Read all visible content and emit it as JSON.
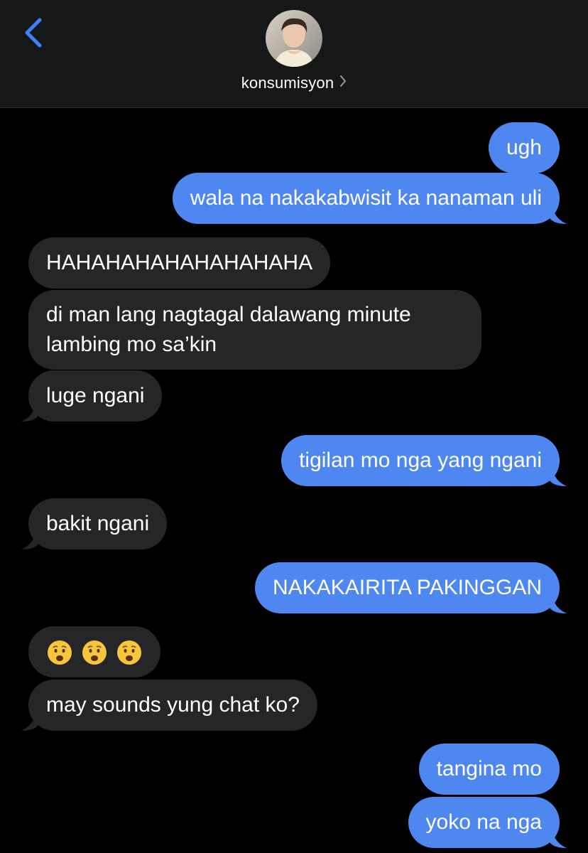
{
  "header": {
    "contact_name": "konsumisyon"
  },
  "messages": [
    {
      "from": "me",
      "text": "ugh"
    },
    {
      "from": "me",
      "text": "wala na nakakabwisit ka nanaman uli"
    },
    {
      "from": "them",
      "text": "HAHAHAHAHAHAHAHAHA"
    },
    {
      "from": "them",
      "text": "di man lang nagtagal dalawang minute lambing mo sa’kin"
    },
    {
      "from": "them",
      "text": "luge ngani"
    },
    {
      "from": "me",
      "text": "tigilan mo nga yang ngani"
    },
    {
      "from": "them",
      "text": "bakit ngani"
    },
    {
      "from": "me",
      "text": "NAKAKAIRITA PAKINGGAN"
    },
    {
      "from": "them",
      "emoji": [
        "anguished-face",
        "anguished-face",
        "anguished-face"
      ]
    },
    {
      "from": "them",
      "text": "may sounds yung chat ko?"
    },
    {
      "from": "me",
      "text": "tangina mo"
    },
    {
      "from": "me",
      "text": "yoko na nga"
    }
  ],
  "colors": {
    "sent_bubble": "#4f87f0",
    "received_bubble": "#262628",
    "header_background": "#161719",
    "accent": "#3b82f6"
  }
}
